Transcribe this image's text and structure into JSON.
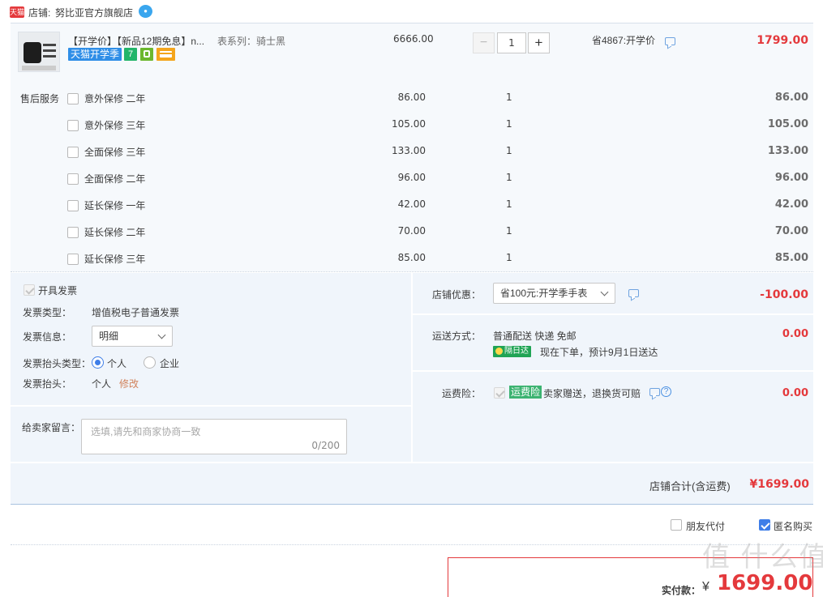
{
  "shop": {
    "tmall_badge": "天猫",
    "label": "店铺:",
    "name": "努比亚官方旗舰店"
  },
  "product": {
    "title": "【开学价】【新品12期免息】n...",
    "spec": "表系列：骑士黑",
    "promo_tag": "天猫开学季",
    "badge_7": "7",
    "price": "6666.00",
    "quantity": "1",
    "qty_minus": "−",
    "qty_plus": "+",
    "discount": "省4867:开学价",
    "subtotal": "1799.00"
  },
  "service": {
    "label": "售后服务",
    "items": [
      {
        "name": "意外保修 二年",
        "price": "86.00",
        "qty": "1",
        "total": "86.00"
      },
      {
        "name": "意外保修 三年",
        "price": "105.00",
        "qty": "1",
        "total": "105.00"
      },
      {
        "name": "全面保修 三年",
        "price": "133.00",
        "qty": "1",
        "total": "133.00"
      },
      {
        "name": "全面保修 二年",
        "price": "96.00",
        "qty": "1",
        "total": "96.00"
      },
      {
        "name": "延长保修 一年",
        "price": "42.00",
        "qty": "1",
        "total": "42.00"
      },
      {
        "name": "延长保修 二年",
        "price": "70.00",
        "qty": "1",
        "total": "70.00"
      },
      {
        "name": "延长保修 三年",
        "price": "85.00",
        "qty": "1",
        "total": "85.00"
      }
    ]
  },
  "invoice": {
    "open_label": "开具发票",
    "type_label": "发票类型：",
    "type_value": "增值税电子普通发票",
    "info_label": "发票信息：",
    "info_value": "明细",
    "header_type_label": "发票抬头类型：",
    "option_personal": "个人",
    "option_company": "企业",
    "header_label": "发票抬头：",
    "header_value": "个人",
    "edit_link": "修改"
  },
  "message": {
    "label": "给卖家留言：",
    "placeholder": "选填,请先和商家协商一致",
    "counter": "0/200"
  },
  "coupon": {
    "label": "店铺优惠：",
    "value": "省100元:开学季手表",
    "amount": "-100.00"
  },
  "delivery": {
    "label": "运送方式：",
    "value": "普通配送 快递 免邮",
    "badge": "隔日达",
    "eta": "现在下单，预计9月1日送达",
    "amount": "0.00"
  },
  "insurance": {
    "label": "运费险：",
    "badge": "运费险",
    "desc": "卖家赠送，退换货可赔",
    "amount": "0.00"
  },
  "shop_total": {
    "label": "店铺合计(含运费)",
    "value": "¥1699.00"
  },
  "options": {
    "friend_pay": "朋友代付",
    "anonymous": "匿名购买"
  },
  "payment": {
    "label": "实付款：",
    "currency": "¥",
    "value": "1699.00"
  },
  "watermark": "值 什么值得买"
}
